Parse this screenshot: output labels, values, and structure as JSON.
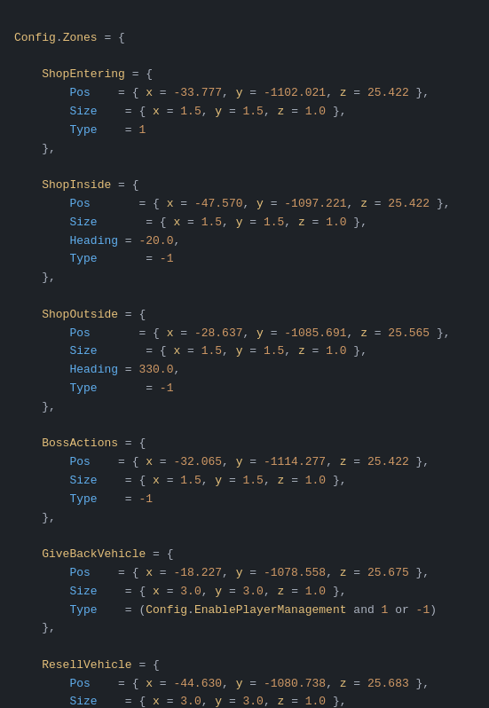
{
  "code": {
    "title": "Config.Zones = {"
  }
}
